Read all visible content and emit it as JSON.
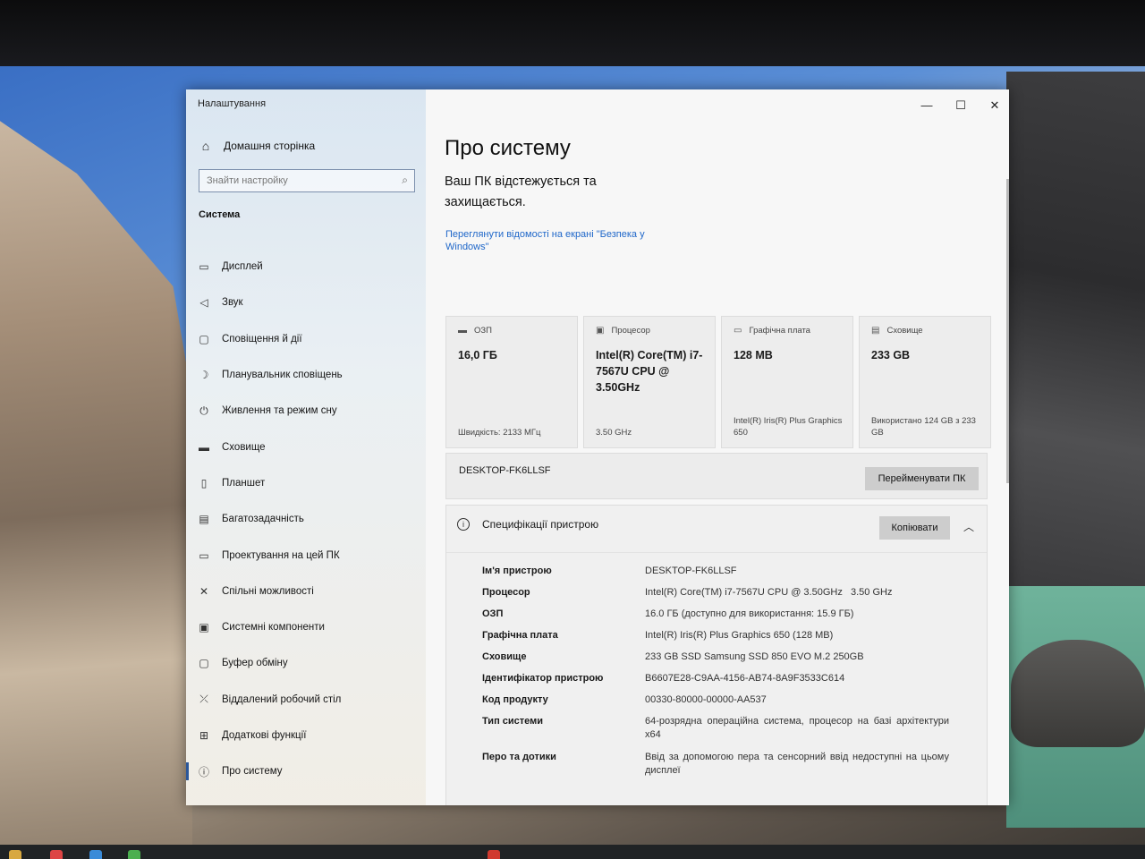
{
  "window": {
    "app_title": "Налаштування",
    "controls": {
      "minimize": "—",
      "maximize": "☐",
      "close": "✕"
    }
  },
  "sidebar": {
    "home": "Домашня сторінка",
    "search_placeholder": "Знайти настройку",
    "section_title": "Система",
    "items": [
      {
        "label": "Дисплей",
        "icon": "monitor-icon"
      },
      {
        "label": "Звук",
        "icon": "speaker-icon"
      },
      {
        "label": "Сповіщення й дії",
        "icon": "notification-icon"
      },
      {
        "label": "Планувальник сповіщень",
        "icon": "moon-icon"
      },
      {
        "label": "Живлення та режим сну",
        "icon": "power-icon"
      },
      {
        "label": "Сховище",
        "icon": "storage-icon"
      },
      {
        "label": "Планшет",
        "icon": "tablet-icon"
      },
      {
        "label": "Багатозадачність",
        "icon": "multitasking-icon"
      },
      {
        "label": "Проектування на цей ПК",
        "icon": "projecting-icon"
      },
      {
        "label": "Спільні можливості",
        "icon": "shared-icon"
      },
      {
        "label": "Системні компоненти",
        "icon": "components-icon"
      },
      {
        "label": "Буфер обміну",
        "icon": "clipboard-icon"
      },
      {
        "label": "Віддалений робочий стіл",
        "icon": "remote-desktop-icon"
      },
      {
        "label": "Додаткові функції",
        "icon": "add-features-icon"
      },
      {
        "label": "Про систему",
        "icon": "info-icon"
      }
    ]
  },
  "main": {
    "title": "Про систему",
    "protection_text": "Ваш ПК відстежується та захищається.",
    "security_link": "Переглянути відомості на екрані \"Безпека у Windows\"",
    "cards": [
      {
        "title": "ОЗП",
        "value": "16,0 ГБ",
        "sub": "Швидкість: 2133 МГц"
      },
      {
        "title": "Процесор",
        "value": "Intel(R) Core(TM) i7-7567U CPU @ 3.50GHz",
        "sub": "3.50 GHz"
      },
      {
        "title": "Графічна плата",
        "value": "128 MB",
        "sub": "Intel(R) Iris(R) Plus Graphics 650"
      },
      {
        "title": "Сховище",
        "value": "233 GB",
        "sub": "Використано 124 GB з 233 GB"
      }
    ],
    "pc_name": "DESKTOP-FK6LLSF",
    "rename_button": "Перейменувати ПК",
    "specs": {
      "title": "Специфікації пристрою",
      "copy_button": "Копіювати",
      "rows": [
        {
          "label": "Ім'я пристрою",
          "value": "DESKTOP-FK6LLSF"
        },
        {
          "label": "Процесор",
          "value": "Intel(R) Core(TM) i7-7567U CPU @ 3.50GHz   3.50 GHz"
        },
        {
          "label": "ОЗП",
          "value": "16.0 ГБ (доступно для використання: 15.9 ГБ)"
        },
        {
          "label": "Графічна плата",
          "value": "Intel(R) Iris(R) Plus Graphics 650 (128 MB)"
        },
        {
          "label": "Сховище",
          "value": "233 GB SSD Samsung SSD 850 EVO M.2 250GB"
        },
        {
          "label": "Ідентифікатор пристрою",
          "value": "B6607E28-C9AA-4156-AB74-8A9F3533C614"
        },
        {
          "label": "Код продукту",
          "value": "00330-80000-00000-AA537"
        },
        {
          "label": "Тип системи",
          "value": "64-розрядна операційна система, процесор на базі архітектури x64"
        },
        {
          "label": "Перо та дотики",
          "value": "Ввід за допомогою пера та сенсорний ввід недоступні на цьому дисплеї"
        }
      ]
    }
  }
}
